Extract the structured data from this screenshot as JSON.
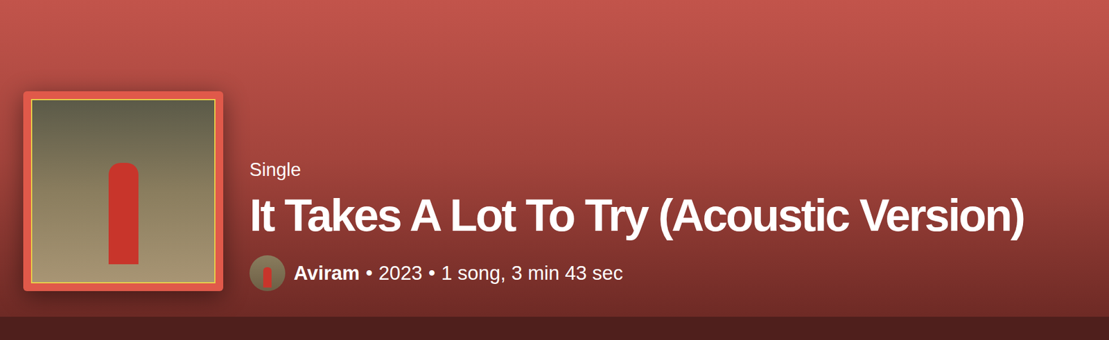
{
  "header": {
    "type": "Single",
    "title": "It Takes A Lot To Try (Acoustic Version)",
    "artist": "Aviram",
    "separator": "•",
    "year": "2023",
    "summary": "1 song, 3 min 43 sec"
  }
}
